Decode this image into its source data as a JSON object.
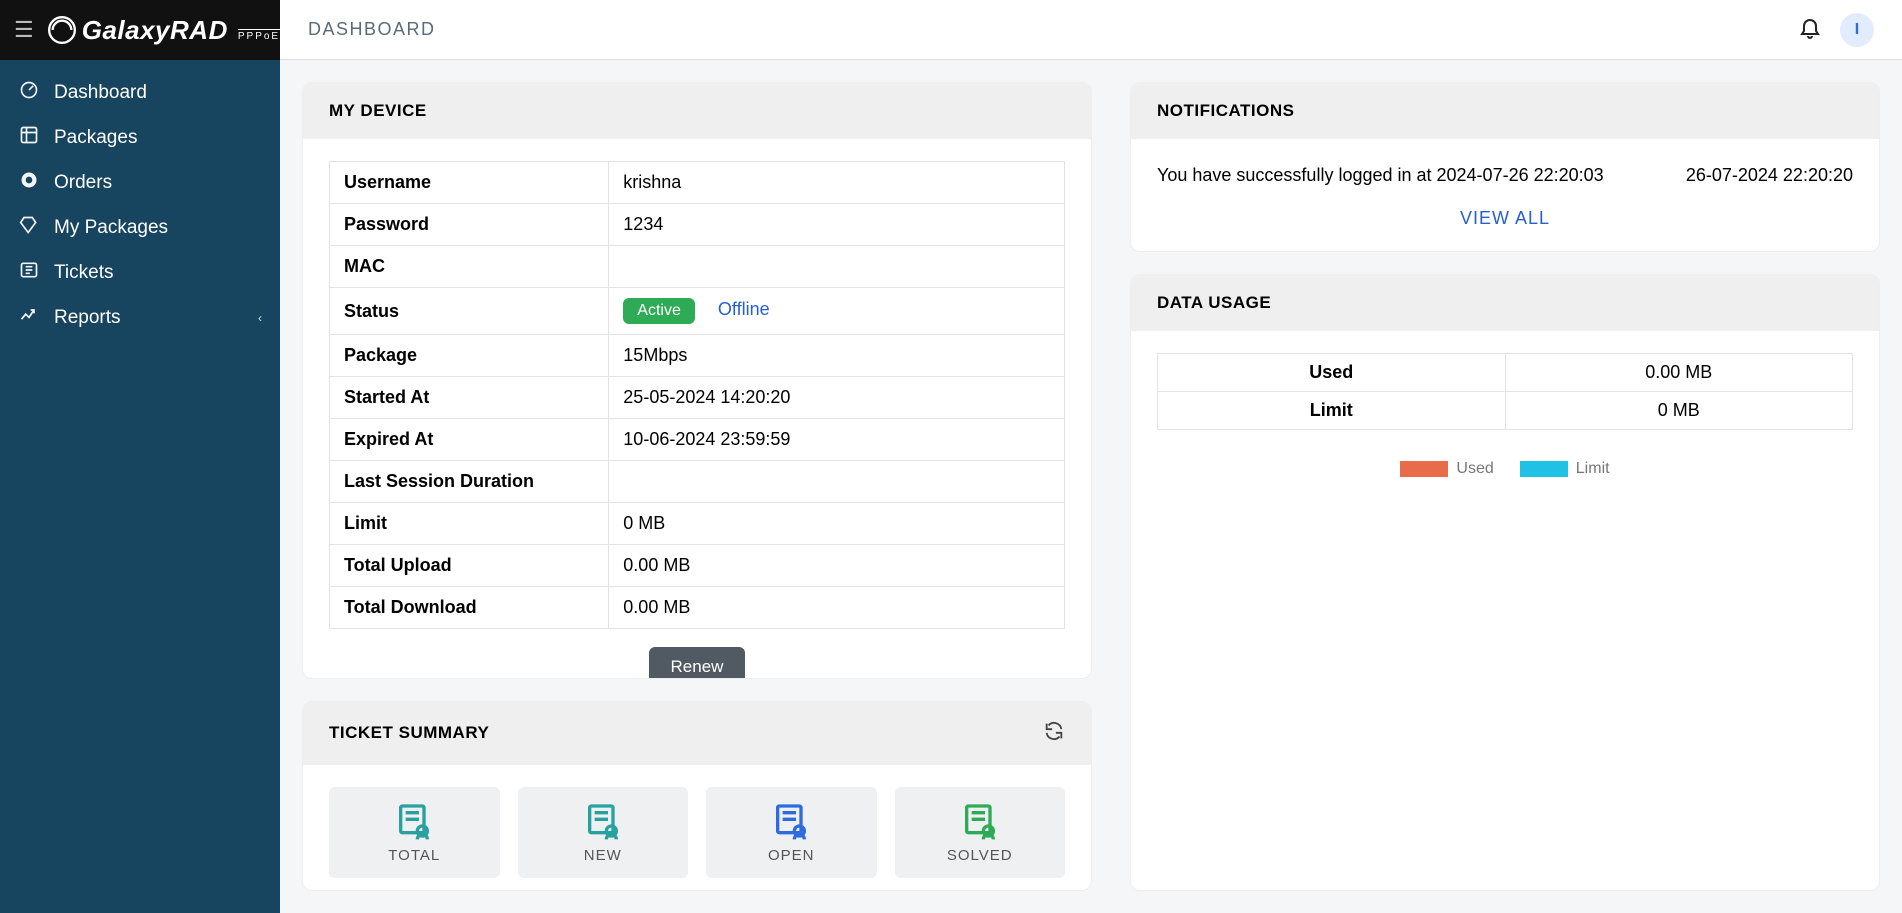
{
  "brand": {
    "name": "GalaxyRAD",
    "sub": "PPPoE"
  },
  "pageTitle": "DASHBOARD",
  "avatarInitial": "I",
  "sidebar": {
    "items": [
      {
        "icon": "gauge",
        "label": "Dashboard"
      },
      {
        "icon": "boxes",
        "label": "Packages"
      },
      {
        "icon": "cart",
        "label": "Orders"
      },
      {
        "icon": "mypkg",
        "label": "My Packages"
      },
      {
        "icon": "ticket",
        "label": "Tickets"
      },
      {
        "icon": "chart",
        "label": "Reports",
        "hasChildren": true
      }
    ]
  },
  "device": {
    "title": "MY DEVICE",
    "rows": {
      "username": {
        "k": "Username",
        "v": "krishna"
      },
      "password": {
        "k": "Password",
        "v": "1234"
      },
      "mac": {
        "k": "MAC",
        "v": ""
      },
      "status": {
        "k": "Status",
        "badge": "Active",
        "link": "Offline"
      },
      "package": {
        "k": "Package",
        "v": "15Mbps"
      },
      "started": {
        "k": "Started At",
        "v": "25-05-2024 14:20:20"
      },
      "expired": {
        "k": "Expired At",
        "v": "10-06-2024 23:59:59"
      },
      "session": {
        "k": "Last Session Duration",
        "v": ""
      },
      "limit": {
        "k": "Limit",
        "v": "0 MB"
      },
      "upload": {
        "k": "Total Upload",
        "v": "0.00 MB"
      },
      "download": {
        "k": "Total Download",
        "v": "0.00 MB"
      }
    },
    "renewLabel": "Renew"
  },
  "notifications": {
    "title": "NOTIFICATIONS",
    "items": [
      {
        "text": "You have successfully logged in at 2024-07-26 22:20:03",
        "time": "26-07-2024 22:20:20"
      }
    ],
    "viewAll": "VIEW ALL"
  },
  "dataUsage": {
    "title": "DATA USAGE",
    "rows": {
      "used": {
        "k": "Used",
        "v": "0.00 MB"
      },
      "limit": {
        "k": "Limit",
        "v": "0 MB"
      }
    },
    "legend": {
      "used": "Used",
      "limit": "Limit"
    },
    "colors": {
      "used": "#e86c4a",
      "limit": "#21c1e6"
    }
  },
  "chart_data": {
    "type": "pie",
    "title": "Data Usage",
    "series": [
      {
        "name": "Used",
        "value": 0.0,
        "unit": "MB",
        "color": "#e86c4a"
      },
      {
        "name": "Limit",
        "value": 0,
        "unit": "MB",
        "color": "#21c1e6"
      }
    ],
    "legend_position": "bottom"
  },
  "tickets": {
    "title": "TICKET SUMMARY",
    "tiles": [
      {
        "label": "TOTAL",
        "color": "#28a0a0"
      },
      {
        "label": "NEW",
        "color": "#28a0a0"
      },
      {
        "label": "OPEN",
        "color": "#2d6cdf"
      },
      {
        "label": "SOLVED",
        "color": "#2eab55"
      }
    ]
  }
}
